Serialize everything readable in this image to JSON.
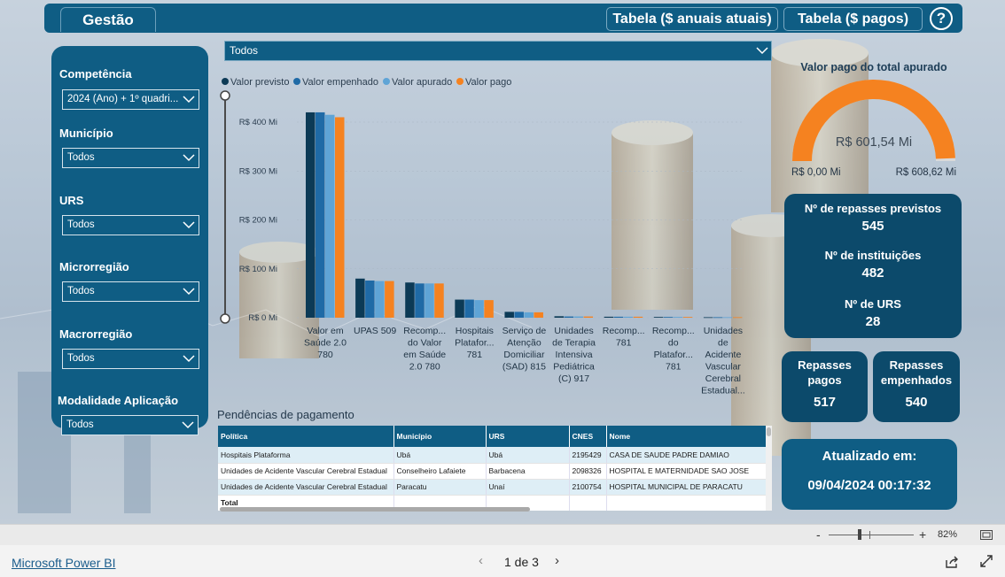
{
  "nav": {
    "tab_gestao": "Gestão",
    "btn_tabela_anuais": "Tabela ($ anuais atuais)",
    "btn_tabela_pagos": "Tabela ($ pagos)",
    "help_icon": "question-circle-icon",
    "help_glyph": "?"
  },
  "filters": {
    "competencia": {
      "label": "Competência",
      "value": "2024 (Ano) + 1º quadri..."
    },
    "municipio": {
      "label": "Município",
      "value": "Todos"
    },
    "urs": {
      "label": "URS",
      "value": "Todos"
    },
    "microrregiao": {
      "label": "Microrregião",
      "value": "Todos"
    },
    "macrorregiao": {
      "label": "Macrorregião",
      "value": "Todos"
    },
    "modalidade": {
      "label": "Modalidade Aplicação",
      "value": "Todos"
    }
  },
  "top_selector": {
    "value": "Todos"
  },
  "chart_data": {
    "type": "bar",
    "title": "",
    "xlabel": "",
    "ylabel": "",
    "ylim": [
      0,
      400
    ],
    "y_ticks": [
      "R$ 0 Mi",
      "R$ 100 Mi",
      "R$ 200 Mi",
      "R$ 300 Mi",
      "R$ 400 Mi"
    ],
    "y_tick_values": [
      0,
      100,
      200,
      300,
      400
    ],
    "legend_position": "top-left",
    "categories": [
      [
        "Valor em",
        "Saúde 2.0",
        "780"
      ],
      [
        "UPAS 509"
      ],
      [
        "Recomp...",
        "do Valor",
        "em Saúde",
        "2.0 780"
      ],
      [
        "Hospitais",
        "Platafor...",
        "781"
      ],
      [
        "Serviço de",
        "Atenção",
        "Domiciliar",
        "(SAD) 815"
      ],
      [
        "Unidades",
        "de Terapia",
        "Intensiva",
        "Pediátrica",
        "(C) 917"
      ],
      [
        "Recomp...",
        "781"
      ],
      [
        "Recomp...",
        "do",
        "Platafor...",
        "781"
      ],
      [
        "Unidades",
        "de",
        "Acidente",
        "Vascular",
        "Cerebral",
        "Estadual..."
      ]
    ],
    "series": [
      {
        "name": "Valor previsto",
        "color": "#0c3a56",
        "values": [
          420,
          80,
          72,
          37,
          12,
          3,
          2,
          1.5,
          1
        ]
      },
      {
        "name": "Valor empenhado",
        "color": "#1f6aa6",
        "values": [
          420,
          76,
          70,
          37,
          12,
          2.5,
          2,
          1.5,
          1
        ]
      },
      {
        "name": "Valor apurado",
        "color": "#5fa4d6",
        "values": [
          415,
          75,
          70,
          36,
          11,
          2.5,
          2,
          1.5,
          1
        ]
      },
      {
        "name": "Valor pago",
        "color": "#f58220",
        "values": [
          410,
          75,
          70,
          36,
          11,
          2.5,
          2,
          1.5,
          1
        ]
      }
    ]
  },
  "pendencias": {
    "title": "Pendências de pagamento",
    "columns": [
      "Política",
      "Município",
      "URS",
      "CNES",
      "Nome"
    ],
    "rows": [
      [
        "Hospitais Plataforma",
        "Ubá",
        "Ubá",
        "2195429",
        "CASA DE SAUDE PADRE DAMIAO"
      ],
      [
        "Unidades de Acidente Vascular Cerebral Estadual",
        "Conselheiro Lafaiete",
        "Barbacena",
        "2098326",
        "HOSPITAL E MATERNIDADE SAO JOSE"
      ],
      [
        "Unidades de Acidente Vascular Cerebral Estadual",
        "Paracatu",
        "Unaí",
        "2100754",
        "HOSPITAL MUNICIPAL DE PARACATU"
      ]
    ],
    "total_label": "Total"
  },
  "gauge": {
    "title": "Valor pago do total apurado",
    "value_label": "R$ 601,54 Mi",
    "min_label": "R$ 0,00 Mi",
    "max_label": "R$ 608,62 Mi",
    "value": 601.54,
    "max": 608.62,
    "color": "#f58220"
  },
  "kpis": {
    "repasses_previstos": {
      "label": "Nº de repasses previstos",
      "value": "545"
    },
    "instituicoes": {
      "label": "Nº de instituições",
      "value": "482"
    },
    "urs": {
      "label": "Nº de URS",
      "value": "28"
    },
    "repasses_pagos": {
      "label_1": "Repasses",
      "label_2": "pagos",
      "value": "517"
    },
    "repasses_empenhados": {
      "label_1": "Repasses",
      "label_2": "empenhados",
      "value": "540"
    }
  },
  "updated": {
    "label": "Atualizado em:",
    "value": "09/04/2024 00:17:32"
  },
  "statusbar": {
    "zoom_minus": "-",
    "zoom_plus": "+",
    "zoom_level": "82%"
  },
  "footer": {
    "brand": "Microsoft Power BI",
    "page_label": "1 de 3",
    "prev_glyph": "‹",
    "next_glyph": "›"
  },
  "colors": {
    "brand": "#0f5d84",
    "card_dark": "#0c4a6b",
    "accent": "#f58220"
  }
}
